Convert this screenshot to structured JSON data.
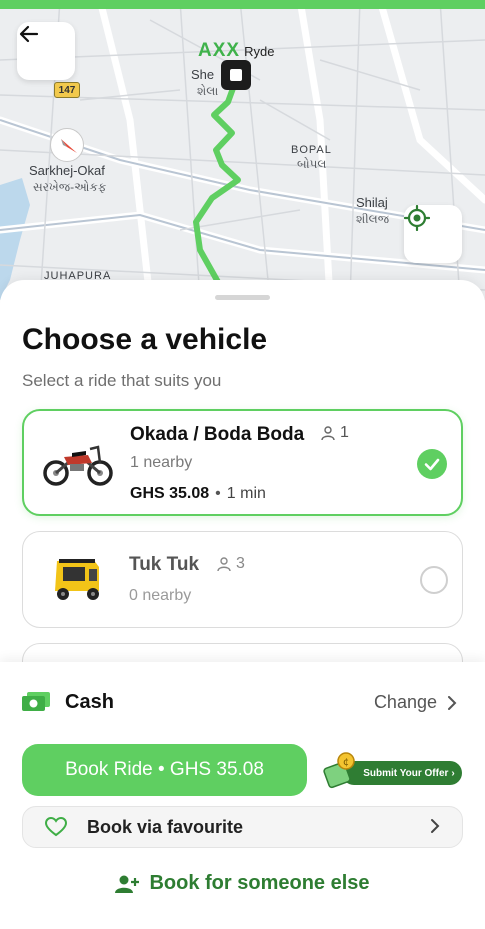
{
  "map": {
    "brand_mark": "AXX",
    "brand_text": "Ryde",
    "highway": "147",
    "labels": {
      "she": "She",
      "she_gu": "શેલા",
      "sarkhej": "Sarkhej-Okaf",
      "sarkhej_gu": "સરખેજ-ઓકફ",
      "bopal": "BOPAL",
      "bopal_gu": "બોપલ",
      "shilaj": "Shilaj",
      "shilaj_gu": "શીલજ",
      "juhapura": "JUHAPURA"
    },
    "route_color": "#5fcf61"
  },
  "sheet": {
    "title": "Choose a vehicle",
    "subtitle": "Select a ride that suits you",
    "vehicles": [
      {
        "name": "Okada / Boda Boda",
        "seats": "1",
        "nearby": "1 nearby",
        "price": "GHS 35.08",
        "eta": "1 min",
        "selected": true,
        "icon": "motorbike-icon"
      },
      {
        "name": "Tuk Tuk",
        "seats": "3",
        "nearby": "0 nearby",
        "selected": false,
        "icon": "tuk-tuk-icon"
      }
    ]
  },
  "payment": {
    "method": "Cash",
    "change_label": "Change"
  },
  "actions": {
    "book_label": "Book Ride • GHS 35.08",
    "offer_label": "Submit Your Offer",
    "favourite_label": "Book via favourite",
    "someone_label": "Book for someone else"
  },
  "colors": {
    "accent": "#5fcf61",
    "accent_dark": "#2e7d32"
  }
}
